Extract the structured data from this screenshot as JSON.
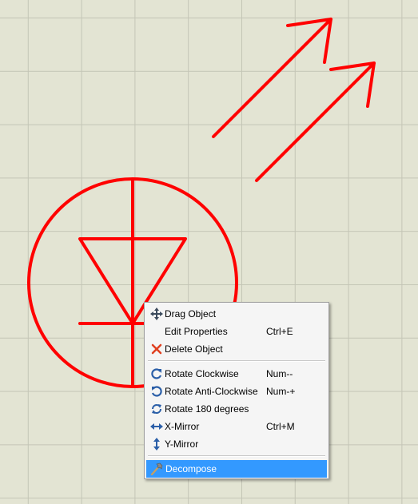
{
  "context_menu": {
    "items": [
      {
        "label": "Drag Object",
        "shortcut": "",
        "icon": "move-arrows-icon"
      },
      {
        "label": "Edit Properties",
        "shortcut": "Ctrl+E",
        "icon": ""
      },
      {
        "label": "Delete Object",
        "shortcut": "",
        "icon": "delete-x-icon"
      },
      {
        "label": "Rotate Clockwise",
        "shortcut": "Num--",
        "icon": "rotate-clockwise-icon"
      },
      {
        "label": "Rotate Anti-Clockwise",
        "shortcut": "Num-+",
        "icon": "rotate-anticlockwise-icon"
      },
      {
        "label": "Rotate 180 degrees",
        "shortcut": "",
        "icon": "rotate-180-icon"
      },
      {
        "label": "X-Mirror",
        "shortcut": "Ctrl+M",
        "icon": "x-mirror-icon"
      },
      {
        "label": "Y-Mirror",
        "shortcut": "",
        "icon": "y-mirror-icon"
      },
      {
        "label": "Decompose",
        "shortcut": "",
        "icon": "hammer-icon",
        "highlighted": true
      }
    ]
  },
  "colors": {
    "schematic_stroke": "#ff0000",
    "canvas_background": "#e3e4d3",
    "grid_line": "#c4c5b6",
    "menu_highlight": "#3399ff"
  },
  "schematic": {
    "component": "led-symbol-icon"
  }
}
